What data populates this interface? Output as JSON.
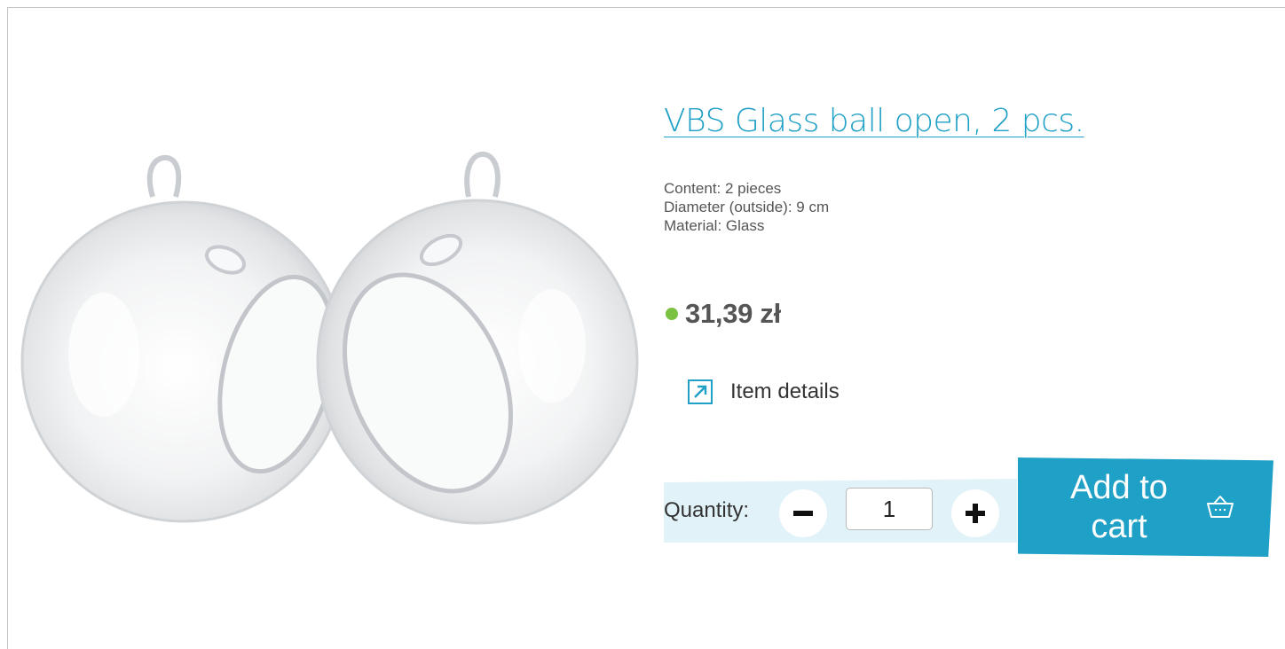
{
  "product": {
    "title": "VBS Glass ball open, 2 pcs.",
    "specs": [
      "Content: 2 pieces",
      "Diameter (outside): 9 cm",
      "Material: Glass"
    ],
    "price": "31,39 zł",
    "stock_status_color": "#7cc242",
    "image_icon": "product-photo-glass-balls"
  },
  "details_link": {
    "label": "Item details",
    "icon": "external-link-arrow-icon"
  },
  "quantity": {
    "label": "Quantity:",
    "value": "1",
    "decrement_icon": "minus-icon",
    "increment_icon": "plus-icon"
  },
  "add_to_cart": {
    "label": "Add to\ncart",
    "icon": "basket-icon"
  },
  "colors": {
    "accent": "#1fa0c6",
    "quantity_panel": "#e1f3f9",
    "text": "#555555"
  }
}
